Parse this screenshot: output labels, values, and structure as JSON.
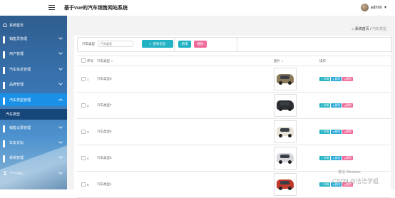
{
  "header": {
    "title": "基于vue的汽车销售网站系统",
    "user": "admin"
  },
  "sidebar": {
    "items": [
      {
        "label": "系统首页",
        "icon": "home-icon"
      },
      {
        "label": "销售员管理",
        "icon": "grid-icon"
      },
      {
        "label": "用户管理",
        "icon": "grid-icon"
      },
      {
        "label": "汽车信息管理",
        "icon": "grid-icon"
      },
      {
        "label": "品牌管理",
        "icon": "grid-icon"
      },
      {
        "label": "汽车类型管理",
        "icon": "grid-icon"
      },
      {
        "label": "销售记录管理",
        "icon": "grid-icon"
      },
      {
        "label": "车友论坛",
        "icon": "grid-icon"
      },
      {
        "label": "系统管理",
        "icon": "grid-icon"
      },
      {
        "label": "个人中心",
        "icon": "user-icon"
      }
    ],
    "submenu": "汽车类型"
  },
  "breadcrumb": {
    "home": "系统首页",
    "sep": "/",
    "current": "汽车类型"
  },
  "search": {
    "label": "汽车类型",
    "placeholder": "汽车类型",
    "button": "查询信息"
  },
  "actions": {
    "add": "新增",
    "delete": "删除"
  },
  "table": {
    "headers": {
      "index": "序号",
      "name": "汽车类型",
      "image": "图片",
      "ops": "操作"
    },
    "ops": {
      "detail": "详情",
      "edit": "修改",
      "delete": "删除"
    },
    "rows": [
      {
        "index": "1",
        "name": "汽车类型8",
        "color": "#8b7a5a"
      },
      {
        "index": "2",
        "name": "汽车类型7",
        "color": "#2b2f33"
      },
      {
        "index": "3",
        "name": "汽车类型6",
        "color": "#e8e3d8"
      },
      {
        "index": "4",
        "name": "汽车类型5",
        "color": "#d6d8de"
      },
      {
        "index": "5",
        "name": "汽车类型4",
        "color": "#c0392b"
      }
    ]
  },
  "watermark": {
    "line1": "激活 Windows",
    "line2": "CSDN @洁洁学姐"
  }
}
